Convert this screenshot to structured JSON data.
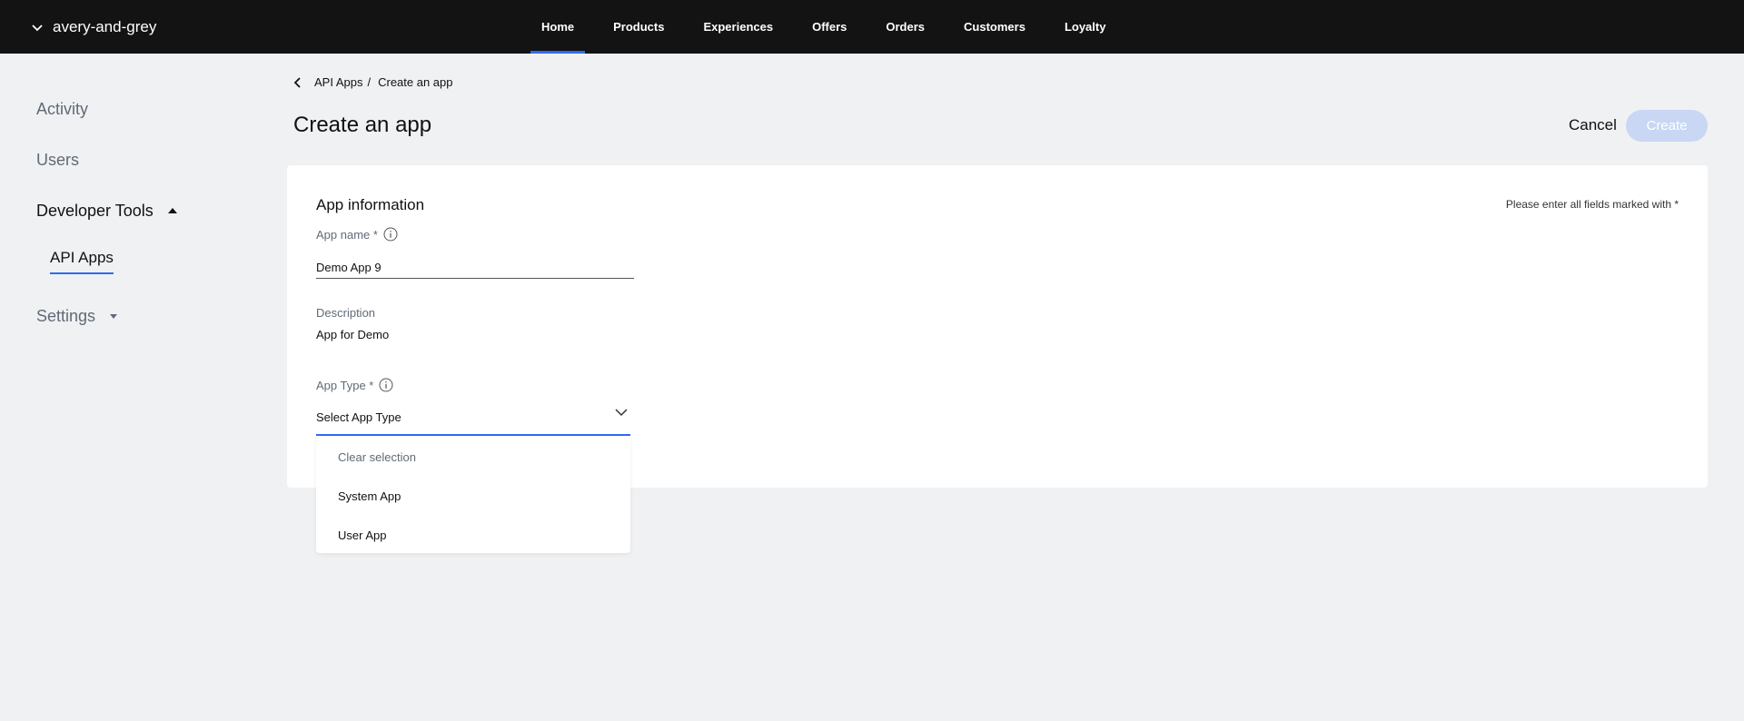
{
  "topbar": {
    "org_name": "avery-and-grey",
    "nav": [
      {
        "label": "Home",
        "active": true
      },
      {
        "label": "Products"
      },
      {
        "label": "Experiences"
      },
      {
        "label": "Offers"
      },
      {
        "label": "Orders"
      },
      {
        "label": "Customers"
      },
      {
        "label": "Loyalty"
      }
    ]
  },
  "sidebar": {
    "activity": "Activity",
    "users": "Users",
    "developer_tools": "Developer Tools",
    "api_apps": "API Apps",
    "settings": "Settings"
  },
  "breadcrumb": {
    "parent": "API Apps",
    "separator": "/",
    "current": "Create an app"
  },
  "page": {
    "title": "Create an app",
    "cancel_label": "Cancel",
    "create_label": "Create"
  },
  "form": {
    "section_title": "App information",
    "required_note": "Please enter all fields marked with *",
    "app_name_label": "App name *",
    "app_name_value": "Demo App 9",
    "description_label": "Description",
    "description_value": "App for Demo",
    "app_type_label": "App Type *",
    "app_type_placeholder": "Select App Type",
    "app_type_options": [
      "Clear selection",
      "System App",
      "User App"
    ]
  },
  "colors": {
    "accent": "#2f6cf0",
    "topbar_bg": "#131313",
    "page_bg": "#f0f1f3",
    "create_disabled": "#c9d7f4"
  }
}
